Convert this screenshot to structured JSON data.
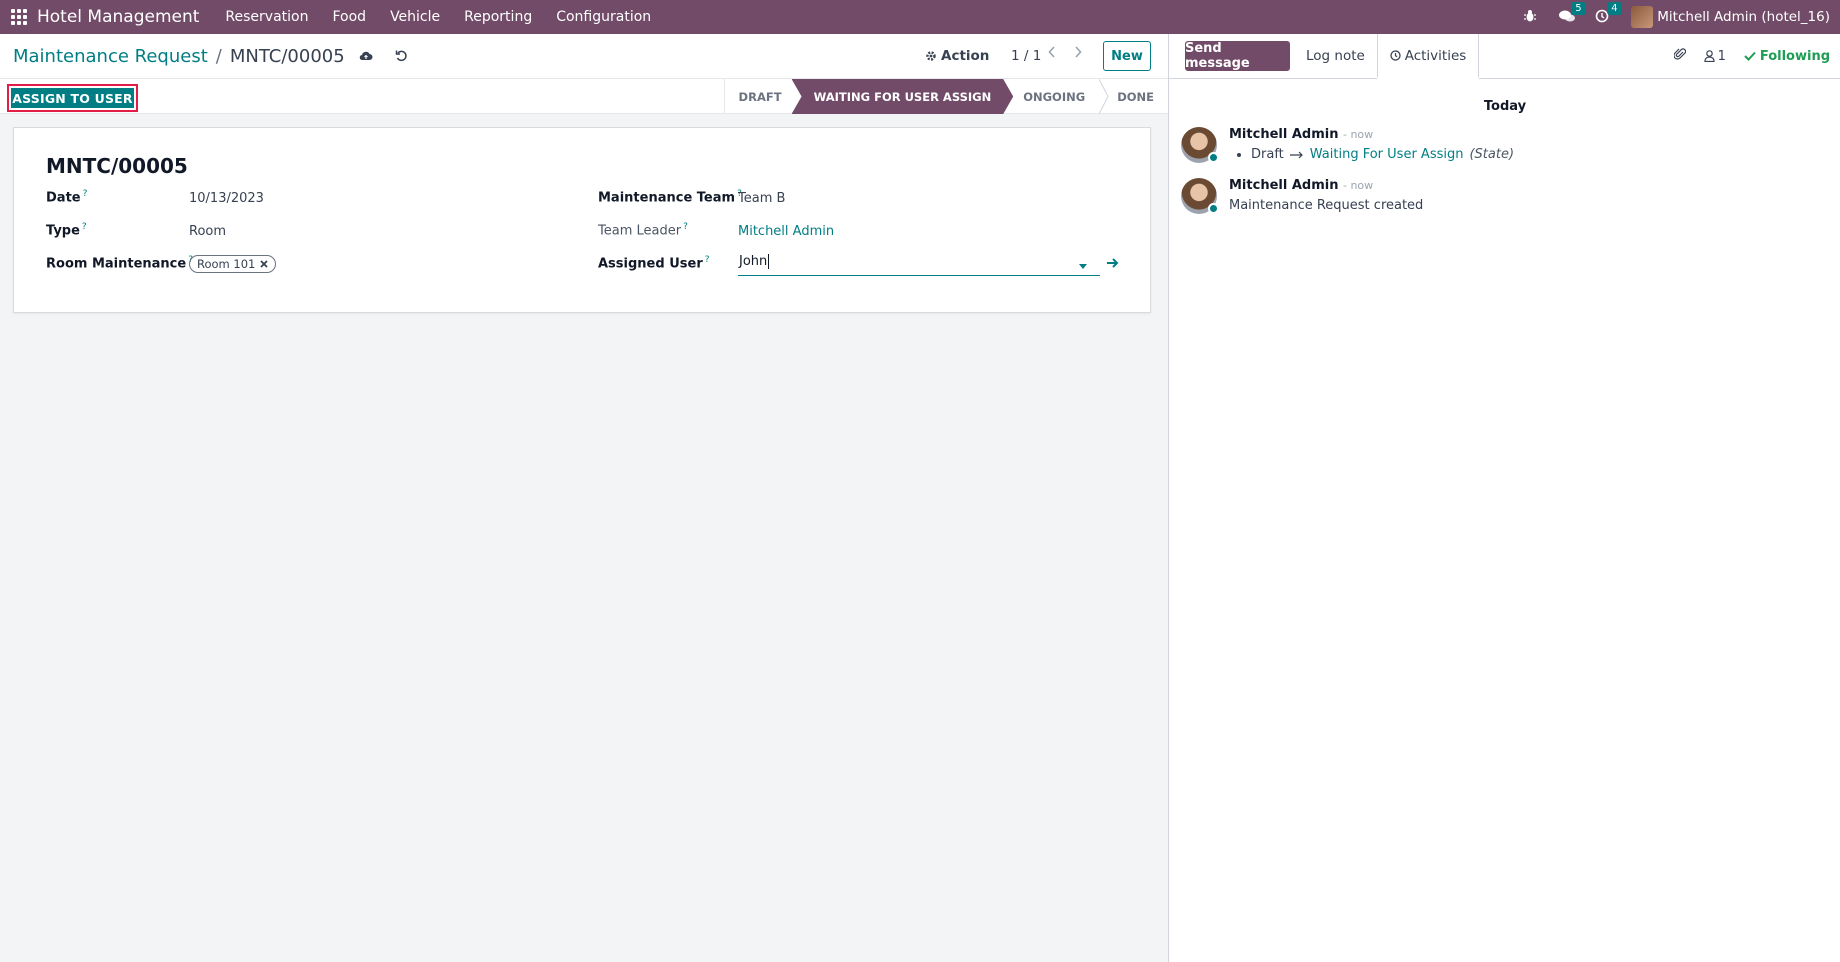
{
  "navbar": {
    "app_name": "Hotel Management",
    "menus": [
      "Reservation",
      "Food",
      "Vehicle",
      "Reporting",
      "Configuration"
    ],
    "messages_count": "5",
    "activities_count": "4",
    "user": "Mitchell Admin (hotel_16)"
  },
  "breadcrumb": {
    "parent": "Maintenance Request",
    "separator": "/",
    "current": "MNTC/00005"
  },
  "control": {
    "action_label": "Action",
    "pager": "1 / 1",
    "new_label": "New"
  },
  "statusbar": {
    "assign_label": "ASSIGN TO USER",
    "stages": [
      "DRAFT",
      "WAITING FOR USER ASSIGN",
      "ONGOING",
      "DONE"
    ],
    "active_stage": "WAITING FOR USER ASSIGN"
  },
  "form": {
    "title": "MNTC/00005",
    "date_label": "Date",
    "date_value": "10/13/2023",
    "type_label": "Type",
    "type_value": "Room",
    "room_label": "Room Maintenance",
    "room_tag": "Room 101",
    "team_label": "Maintenance Team",
    "team_value": "Team B",
    "leader_label": "Team Leader",
    "leader_value": "Mitchell Admin",
    "assigned_label": "Assigned User",
    "assigned_value": "John",
    "help_mark": "?"
  },
  "chatter": {
    "send_message": "Send message",
    "log_note": "Log note",
    "activities": "Activities",
    "followers_count": "1",
    "following": "Following",
    "today": "Today",
    "messages": [
      {
        "author": "Mitchell Admin",
        "time": "- now",
        "from": "Draft",
        "to": "Waiting For User Assign",
        "field": "(State)"
      },
      {
        "author": "Mitchell Admin",
        "time": "- now",
        "body": "Maintenance Request created"
      }
    ]
  },
  "colors": {
    "brand": "#714b67",
    "accent": "#017e84",
    "highlight_border": "#e11d48",
    "following": "#1f9d55"
  }
}
